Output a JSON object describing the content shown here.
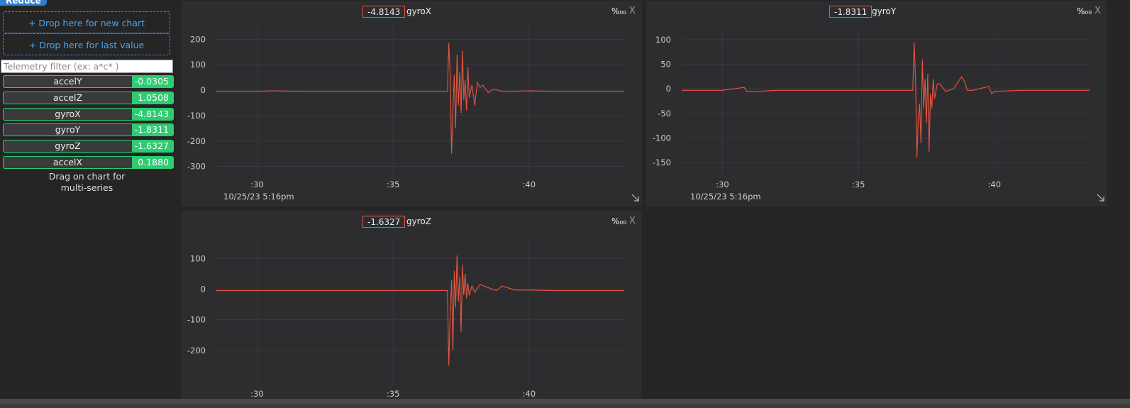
{
  "sidebar": {
    "reduce_label": "Reduce",
    "drop_new_chart": "+ Drop here for new chart",
    "drop_last_value": "+ Drop here for last value",
    "filter_placeholder": "Telemetry filter (ex: a*c* )",
    "items": [
      {
        "name": "accelY",
        "value": "-0.0305"
      },
      {
        "name": "accelZ",
        "value": "1.0508"
      },
      {
        "name": "gyroX",
        "value": "-4.8143"
      },
      {
        "name": "gyroY",
        "value": "-1.8311"
      },
      {
        "name": "gyroZ",
        "value": "-1.6327"
      },
      {
        "name": "accelX",
        "value": "0.1880"
      }
    ],
    "drag_hint_line1": "Drag on chart for",
    "drag_hint_line2": "multi-series"
  },
  "colors": {
    "accent_green": "#2ecc71",
    "drop_blue": "#3794e6",
    "series_red": "#e8553f",
    "panel_bg": "#2d2d30",
    "app_bg": "#252526"
  },
  "icons": {
    "close": "close-icon",
    "unit": "per-mille-icon",
    "resize": "resize-corner-icon"
  },
  "chart_data": [
    {
      "type": "line",
      "title": "gyroX",
      "current_value": "-4.8143",
      "unit_label": "%₀₀",
      "close_label": "X",
      "date_label": "10/25/23 5:16pm",
      "x_ticks": [
        ":30",
        ":35",
        ":40"
      ],
      "x_tick_values": [
        30,
        35,
        40
      ],
      "xlim": [
        28.5,
        43.5
      ],
      "y_ticks": [
        "200",
        "100",
        "0",
        "-100",
        "-200",
        "-300"
      ],
      "y_tick_values": [
        200,
        100,
        0,
        -100,
        -200,
        -300
      ],
      "ylim": [
        -340,
        240
      ],
      "series": [
        {
          "x": [
            28.5,
            30.0,
            30.5,
            32.0,
            34.0,
            36.0,
            36.8,
            37.0,
            37.05,
            37.1,
            37.15,
            37.2,
            37.25,
            37.3,
            37.35,
            37.4,
            37.45,
            37.5,
            37.55,
            37.6,
            37.65,
            37.7,
            37.75,
            37.8,
            37.9,
            38.0,
            38.1,
            38.2,
            38.3,
            38.5,
            38.7,
            39.0,
            39.5,
            40.0,
            41.0,
            42.0,
            43.5
          ],
          "y": [
            -5,
            -5,
            -3,
            -5,
            -5,
            -5,
            -5,
            -5,
            185,
            60,
            -250,
            -80,
            60,
            -150,
            140,
            -60,
            70,
            -90,
            155,
            -40,
            40,
            -80,
            90,
            -30,
            20,
            -60,
            30,
            10,
            20,
            -10,
            5,
            -5,
            -4,
            -3,
            -5,
            -5,
            -5
          ]
        }
      ]
    },
    {
      "type": "line",
      "title": "gyroY",
      "current_value": "-1.8311",
      "unit_label": "%₀₀",
      "close_label": "X",
      "date_label": "10/25/23 5:16pm",
      "x_ticks": [
        ":30",
        ":35",
        ":40"
      ],
      "x_tick_values": [
        30,
        35,
        40
      ],
      "xlim": [
        28.5,
        43.5
      ],
      "y_ticks": [
        "100",
        "50",
        "0",
        "-50",
        "-100",
        "-150"
      ],
      "y_tick_values": [
        100,
        50,
        0,
        -50,
        -100,
        -150
      ],
      "ylim": [
        -170,
        110
      ],
      "series": [
        {
          "x": [
            28.5,
            30.0,
            30.8,
            30.9,
            32.0,
            34.0,
            36.0,
            36.8,
            37.0,
            37.05,
            37.1,
            37.15,
            37.2,
            37.25,
            37.3,
            37.35,
            37.4,
            37.45,
            37.5,
            37.55,
            37.6,
            37.65,
            37.7,
            37.75,
            37.8,
            37.9,
            38.0,
            38.2,
            38.5,
            38.8,
            38.9,
            39.0,
            39.2,
            39.8,
            39.9,
            40.0,
            41.0,
            43.5
          ],
          "y": [
            -3,
            -3,
            3,
            -6,
            -3,
            -3,
            -3,
            -3,
            -3,
            95,
            20,
            -140,
            -60,
            -30,
            -110,
            60,
            -40,
            20,
            -70,
            30,
            -128,
            -10,
            -40,
            20,
            -20,
            10,
            10,
            -5,
            0,
            25,
            15,
            -3,
            -3,
            5,
            -10,
            -5,
            -3,
            -3
          ]
        }
      ]
    },
    {
      "type": "line",
      "title": "gyroZ",
      "current_value": "-1.6327",
      "unit_label": "%₀₀",
      "close_label": "X",
      "date_label": "",
      "x_ticks": [
        ":30",
        ":35",
        ":40"
      ],
      "x_tick_values": [
        30,
        35,
        40
      ],
      "xlim": [
        28.5,
        43.5
      ],
      "y_ticks": [
        "100",
        "0",
        "-100",
        "-200"
      ],
      "y_tick_values": [
        100,
        0,
        -100,
        -200
      ],
      "ylim": [
        -300,
        140
      ],
      "series": [
        {
          "x": [
            28.5,
            30.0,
            32.0,
            34.0,
            36.0,
            36.9,
            37.0,
            37.05,
            37.1,
            37.15,
            37.2,
            37.25,
            37.3,
            37.35,
            37.4,
            37.45,
            37.5,
            37.55,
            37.6,
            37.65,
            37.7,
            37.75,
            37.8,
            37.9,
            38.0,
            38.2,
            38.5,
            38.8,
            39.0,
            39.5,
            40.0,
            41.0,
            43.5
          ],
          "y": [
            -5,
            -5,
            -5,
            -5,
            -5,
            -5,
            -5,
            -250,
            -80,
            30,
            -200,
            60,
            -60,
            110,
            -40,
            40,
            -140,
            80,
            -20,
            50,
            -30,
            20,
            -20,
            10,
            -10,
            15,
            5,
            -5,
            10,
            -3,
            -3,
            -5,
            -5
          ]
        }
      ]
    }
  ]
}
